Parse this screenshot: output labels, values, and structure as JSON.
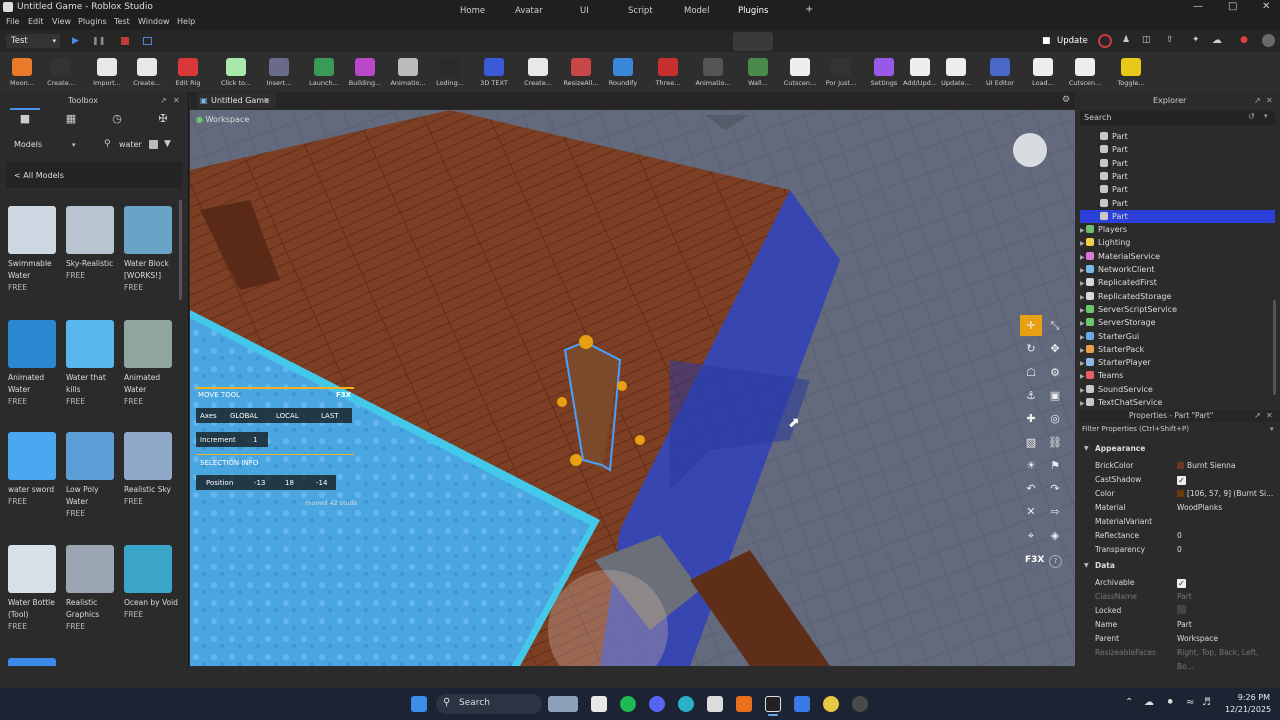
{
  "app": {
    "title": "Untitled Game - Roblox Studio"
  },
  "menu": [
    "File",
    "Edit",
    "View",
    "Plugins",
    "Test",
    "Window",
    "Help"
  ],
  "top": {
    "mode_select": "Test",
    "tabs": [
      "Home",
      "Avatar",
      "UI",
      "Script",
      "Model",
      "Plugins"
    ],
    "active_tab": "Plugins",
    "add_tab": "+",
    "update_label": "Update"
  },
  "ribbon": [
    "Moon...",
    "Create...",
    "Import...",
    "Create...",
    "Edit Rig",
    "Click to...",
    "Insert...",
    "Launch...",
    "Building...",
    "Animatio...",
    "Loding...",
    "3D TEXT",
    "Create...",
    "ResizeAll...",
    "Roundify",
    "Three...",
    "Animatio...",
    "Wall...",
    "Cutscen...",
    "Por Just...",
    "Settings",
    "Add/Upd...",
    "Update...",
    "UI Editor",
    "Load...",
    "Cutscen...",
    "Toggle..."
  ],
  "toolbox": {
    "title": "Toolbox",
    "category": "Models",
    "search_value": "water",
    "all_models_link": "< All Models",
    "models": [
      {
        "name": "Swimmable Water",
        "price": "FREE",
        "color": "#cfd8e2"
      },
      {
        "name": "Sky-Realistic",
        "price": "FREE",
        "color": "#b8c4d0"
      },
      {
        "name": "Water Block [WORKS!]",
        "price": "FREE",
        "color": "#6aa3c8"
      },
      {
        "name": "Animated Water",
        "price": "FREE",
        "color": "#2a88d0"
      },
      {
        "name": "Water that kills",
        "price": "FREE",
        "color": "#58b8ee"
      },
      {
        "name": "Animated Water",
        "price": "FREE",
        "color": "#8fa6a0"
      },
      {
        "name": "water sword",
        "price": "FREE",
        "color": "#49a8f0"
      },
      {
        "name": "Low Poly Water",
        "price": "FREE",
        "color": "#5c9fd6"
      },
      {
        "name": "Realistic Sky",
        "price": "FREE",
        "color": "#8fa8c8"
      },
      {
        "name": "Water Bottle (Tool)",
        "price": "FREE",
        "color": "#d8e0ea"
      },
      {
        "name": "Realistic Graphics",
        "price": "FREE",
        "color": "#9aa6b2"
      },
      {
        "name": "Ocean by Void",
        "price": "FREE",
        "color": "#3aa5c8"
      }
    ]
  },
  "viewport": {
    "tab_label": "Untitled Game",
    "workspace_label": "Workspace",
    "f3x": {
      "tool_title": "MOVE TOOL",
      "logo": "F3X",
      "axes_label": "Axes",
      "axes": [
        "GLOBAL",
        "LOCAL",
        "LAST"
      ],
      "increment_label": "Increment",
      "increment_value": "1",
      "selection_info": "SELECTION INFO",
      "position_label": "Position",
      "position": [
        "-13",
        "18",
        "-14"
      ],
      "moved_text": "moved 42 studs"
    },
    "f3x_side_logo": "F3X",
    "f3x_help": "?"
  },
  "explorer": {
    "title": "Explorer",
    "search_placeholder": "Search",
    "items": [
      {
        "label": "Part",
        "indent": 1,
        "color": "#c8c8c8"
      },
      {
        "label": "Part",
        "indent": 1,
        "color": "#c8c8c8"
      },
      {
        "label": "Part",
        "indent": 1,
        "color": "#c8c8c8"
      },
      {
        "label": "Part",
        "indent": 1,
        "color": "#c8c8c8"
      },
      {
        "label": "Part",
        "indent": 1,
        "color": "#c8c8c8"
      },
      {
        "label": "Part",
        "indent": 1,
        "color": "#c8c8c8"
      },
      {
        "label": "Part",
        "indent": 1,
        "color": "#c8c8c8",
        "selected": true
      },
      {
        "label": "Players",
        "indent": 0,
        "color": "#6fbf6f"
      },
      {
        "label": "Lighting",
        "indent": 0,
        "color": "#f0d048"
      },
      {
        "label": "MaterialService",
        "indent": 0,
        "color": "#d87ad8"
      },
      {
        "label": "NetworkClient",
        "indent": 0,
        "color": "#7ab8e8"
      },
      {
        "label": "ReplicatedFirst",
        "indent": 0,
        "color": "#d8d8d8"
      },
      {
        "label": "ReplicatedStorage",
        "indent": 0,
        "color": "#d8d8d8"
      },
      {
        "label": "ServerScriptService",
        "indent": 0,
        "color": "#6ac86a"
      },
      {
        "label": "ServerStorage",
        "indent": 0,
        "color": "#6ac86a"
      },
      {
        "label": "StarterGui",
        "indent": 0,
        "color": "#6aa8e8"
      },
      {
        "label": "StarterPack",
        "indent": 0,
        "color": "#e8a048"
      },
      {
        "label": "StarterPlayer",
        "indent": 0,
        "color": "#8fb8e8"
      },
      {
        "label": "Teams",
        "indent": 0,
        "color": "#e86060"
      },
      {
        "label": "SoundService",
        "indent": 0,
        "color": "#c8c8c8"
      },
      {
        "label": "TextChatService",
        "indent": 0,
        "color": "#c8c8c8"
      }
    ]
  },
  "properties": {
    "title": "Properties - Part \"Part\"",
    "filter_placeholder": "Filter Properties (Ctrl+Shift+P)",
    "sections": [
      {
        "name": "Appearance",
        "rows": [
          {
            "key": "BrickColor",
            "value": "Burnt Sienna",
            "swatch": "#6a3924"
          },
          {
            "key": "CastShadow",
            "value": "",
            "check": true
          },
          {
            "key": "Color",
            "value": "[106, 57, 9] (Burnt Si...",
            "swatch": "#6a3909"
          },
          {
            "key": "Material",
            "value": "WoodPlanks"
          },
          {
            "key": "MaterialVariant",
            "value": ""
          },
          {
            "key": "Reflectance",
            "value": "0"
          },
          {
            "key": "Transparency",
            "value": "0"
          }
        ]
      },
      {
        "name": "Data",
        "rows": [
          {
            "key": "Archivable",
            "value": "",
            "check": true
          },
          {
            "key": "ClassName",
            "value": "Part",
            "dim": true
          },
          {
            "key": "Locked",
            "value": "",
            "check": false
          },
          {
            "key": "Name",
            "value": "Part"
          },
          {
            "key": "Parent",
            "value": "Workspace"
          },
          {
            "key": "ResizeableFaces",
            "value": "Right, Top, Back, Left, Bo...",
            "dim": true
          }
        ]
      }
    ]
  },
  "taskbar": {
    "search_label": "Search",
    "time": "9:26 PM",
    "date": "12/21/2025"
  },
  "colors": {
    "accent": "#0078d4",
    "selection": "#3050c8",
    "wood": "#7a3a22",
    "water": "#3a9fd8",
    "f3x_orange": "#e8a010"
  }
}
